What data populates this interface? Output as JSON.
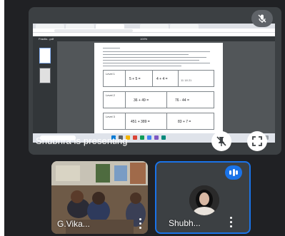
{
  "presentation": {
    "presenting_label": "Shubhra is presenting",
    "pdf_toolbar": {
      "file_name": "Fractio...pdf",
      "zoom": "100%"
    },
    "worksheet_rows": [
      {
        "label": "Level 1",
        "left": "5 + 5 =",
        "mid": "4 + 4 =",
        "right": "11    18    21"
      },
      {
        "label": "Level 2",
        "left": "36 + 49 =",
        "mid": "",
        "right": "76 - 44 ="
      },
      {
        "label": "Level 3",
        "left": "451 + 389 =",
        "mid": "",
        "right": "83 + 7 ="
      }
    ]
  },
  "controls": {
    "mic_off_icon": "mic-off-icon",
    "stop_presenting_icon": "pin-off-icon",
    "fullscreen_icon": "fullscreen-icon"
  },
  "participants": [
    {
      "name": "G.Vika...",
      "speaking": false
    },
    {
      "name": "Shubh...",
      "speaking": true
    }
  ],
  "colors": {
    "background": "#202124",
    "tile": "#3c4043",
    "accent_blue": "#1a73e8",
    "text": "#ffffff"
  }
}
